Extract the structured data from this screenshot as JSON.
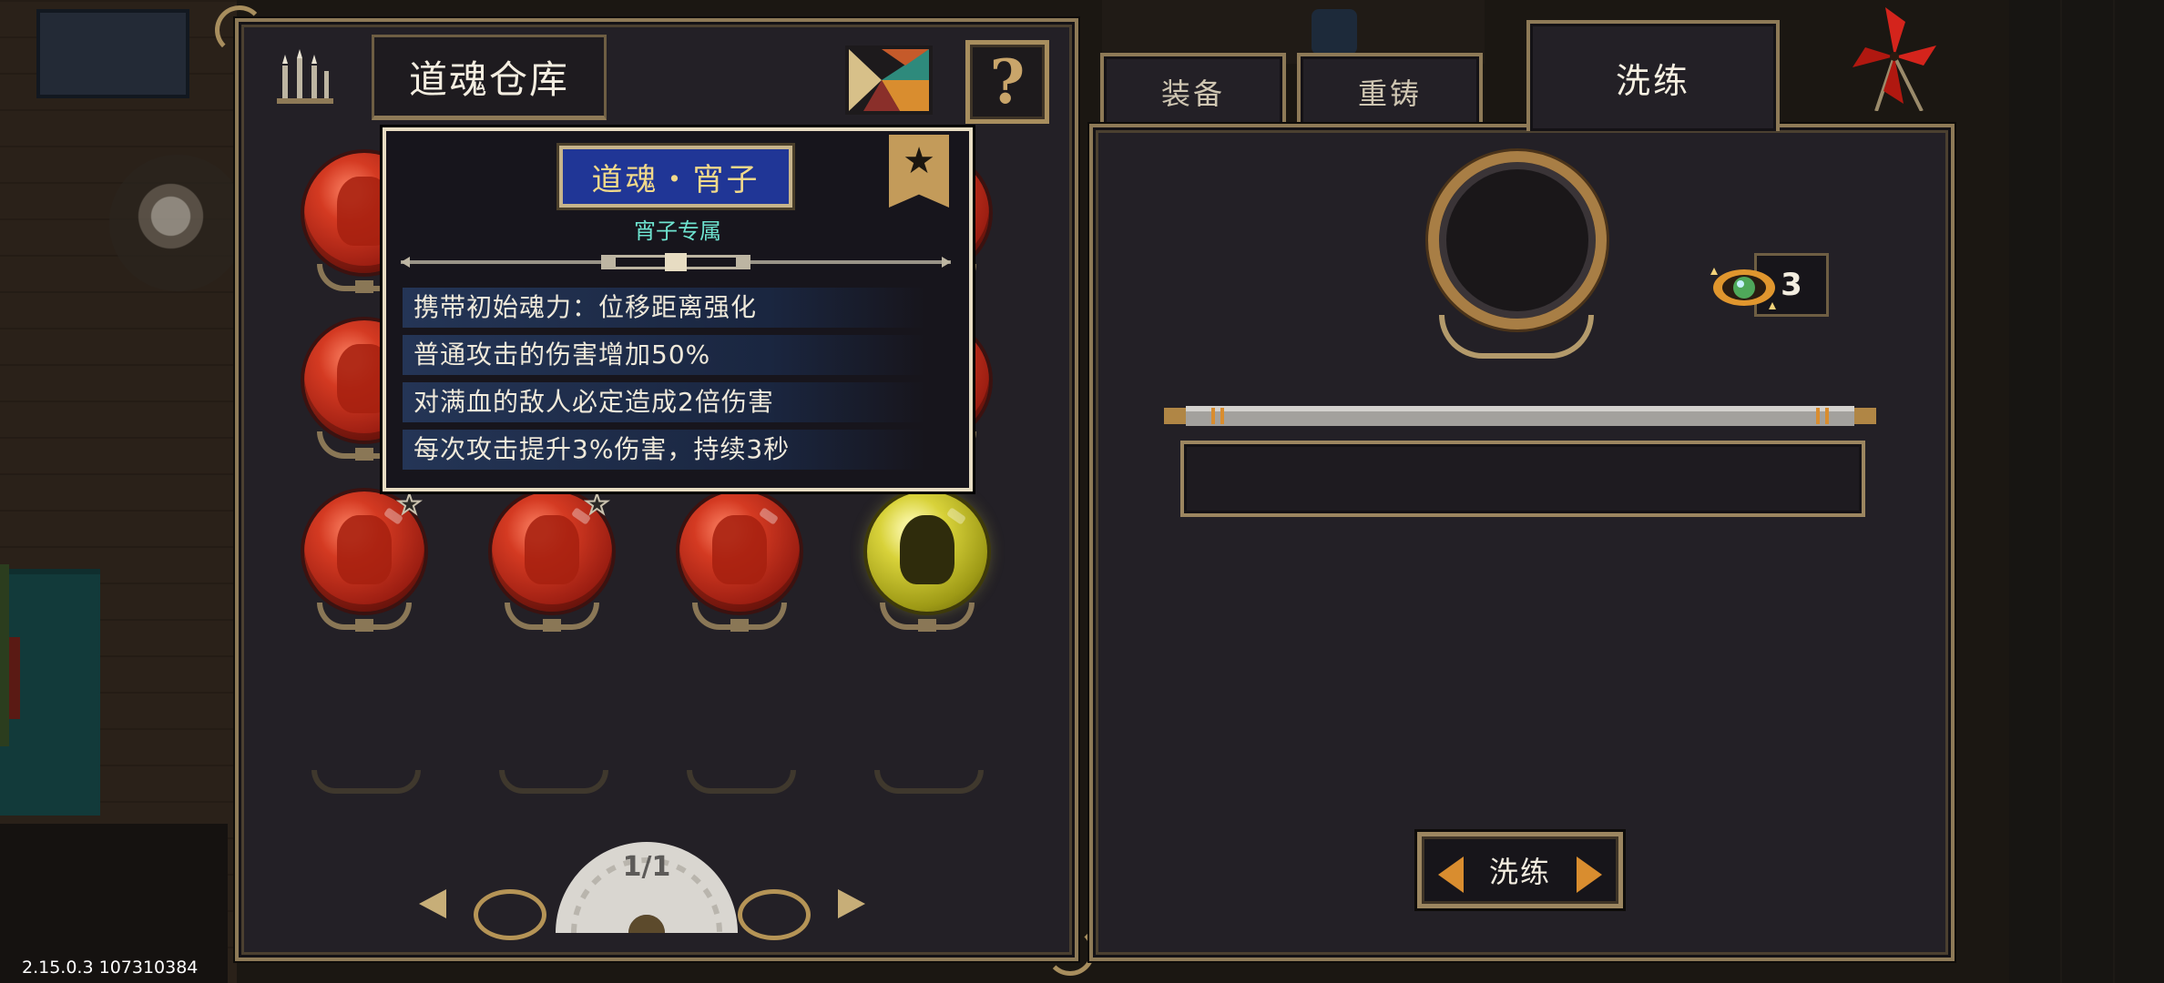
{
  "left_panel": {
    "title": "道魂仓库",
    "help_label": "?"
  },
  "tooltip": {
    "soul_name": "道魂・宵子",
    "exclusive_label": "宵子专属",
    "effects": [
      "携带初始魂力：位移距离强化",
      "普通攻击的伤害增加50%",
      "对满血的敌人必定造成2倍伤害",
      "每次攻击提升3%伤害，持续3秒"
    ]
  },
  "pager": {
    "page": "1/1"
  },
  "tabs": {
    "equip": "装备",
    "recast": "重铸",
    "refine": "洗练"
  },
  "right_panel": {
    "currency_count": "3",
    "refine_button": "洗练"
  },
  "version": "2.15.0.3 107310384",
  "icons": {
    "candle": "candle-icon",
    "tangram": "tangram-icon",
    "windmill": "windmill-icon",
    "currency": "spirit-eye-icon",
    "bookmark_star": "star-icon"
  },
  "colors": {
    "panel_border": "#8e7a57",
    "name_plate": "#203696",
    "name_text": "#f1d98a",
    "exclusive_text": "#6ee3cf",
    "refine_gem": "#d98d2f"
  }
}
